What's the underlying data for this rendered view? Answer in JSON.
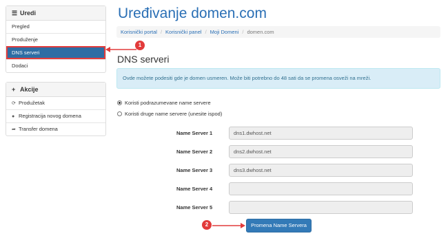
{
  "sidebar": {
    "uredi": {
      "title": "Uredi",
      "icon": "menu-icon",
      "items": [
        {
          "label": "Pregled"
        },
        {
          "label": "Produženje"
        },
        {
          "label": "DNS serveri"
        },
        {
          "label": "Dodaci"
        }
      ]
    },
    "akcije": {
      "title": "Akcije",
      "icon": "plus-icon",
      "items": [
        {
          "label": "Produžetak",
          "icon": "refresh-icon"
        },
        {
          "label": "Registracija novog domena",
          "icon": "globe-icon"
        },
        {
          "label": "Transfer domena",
          "icon": "share-icon"
        }
      ]
    }
  },
  "main": {
    "title": "Uređivanje domen.com",
    "breadcrumb": [
      "Korisnički portal",
      "Korisnički panel",
      "Moji Domeni",
      "domen.com"
    ],
    "section_title": "DNS serveri",
    "info": "Ovde možete podesiti gde je domen usmeren. Može biti potrebno do 48 sati da se promena osveži na mreži.",
    "options": [
      {
        "label": "Koristi podrazumevane name servere",
        "selected": true
      },
      {
        "label": "Koristi druge name servere (unesite ispod)",
        "selected": false
      }
    ],
    "nameservers": [
      {
        "label": "Name Server 1",
        "value": "dns1.dwhost.net"
      },
      {
        "label": "Name Server 2",
        "value": "dns2.dwhost.net"
      },
      {
        "label": "Name Server 3",
        "value": "dns3.dwhost.net"
      },
      {
        "label": "Name Server 4",
        "value": ""
      },
      {
        "label": "Name Server 5",
        "value": ""
      }
    ],
    "submit": "Promena Name Servera"
  },
  "annotations": {
    "step1": "1",
    "step2": "2"
  },
  "colors": {
    "accent": "#2a6fb5",
    "active": "#2e6da4",
    "highlight": "#e23b3b",
    "info_bg": "#d9edf7"
  }
}
